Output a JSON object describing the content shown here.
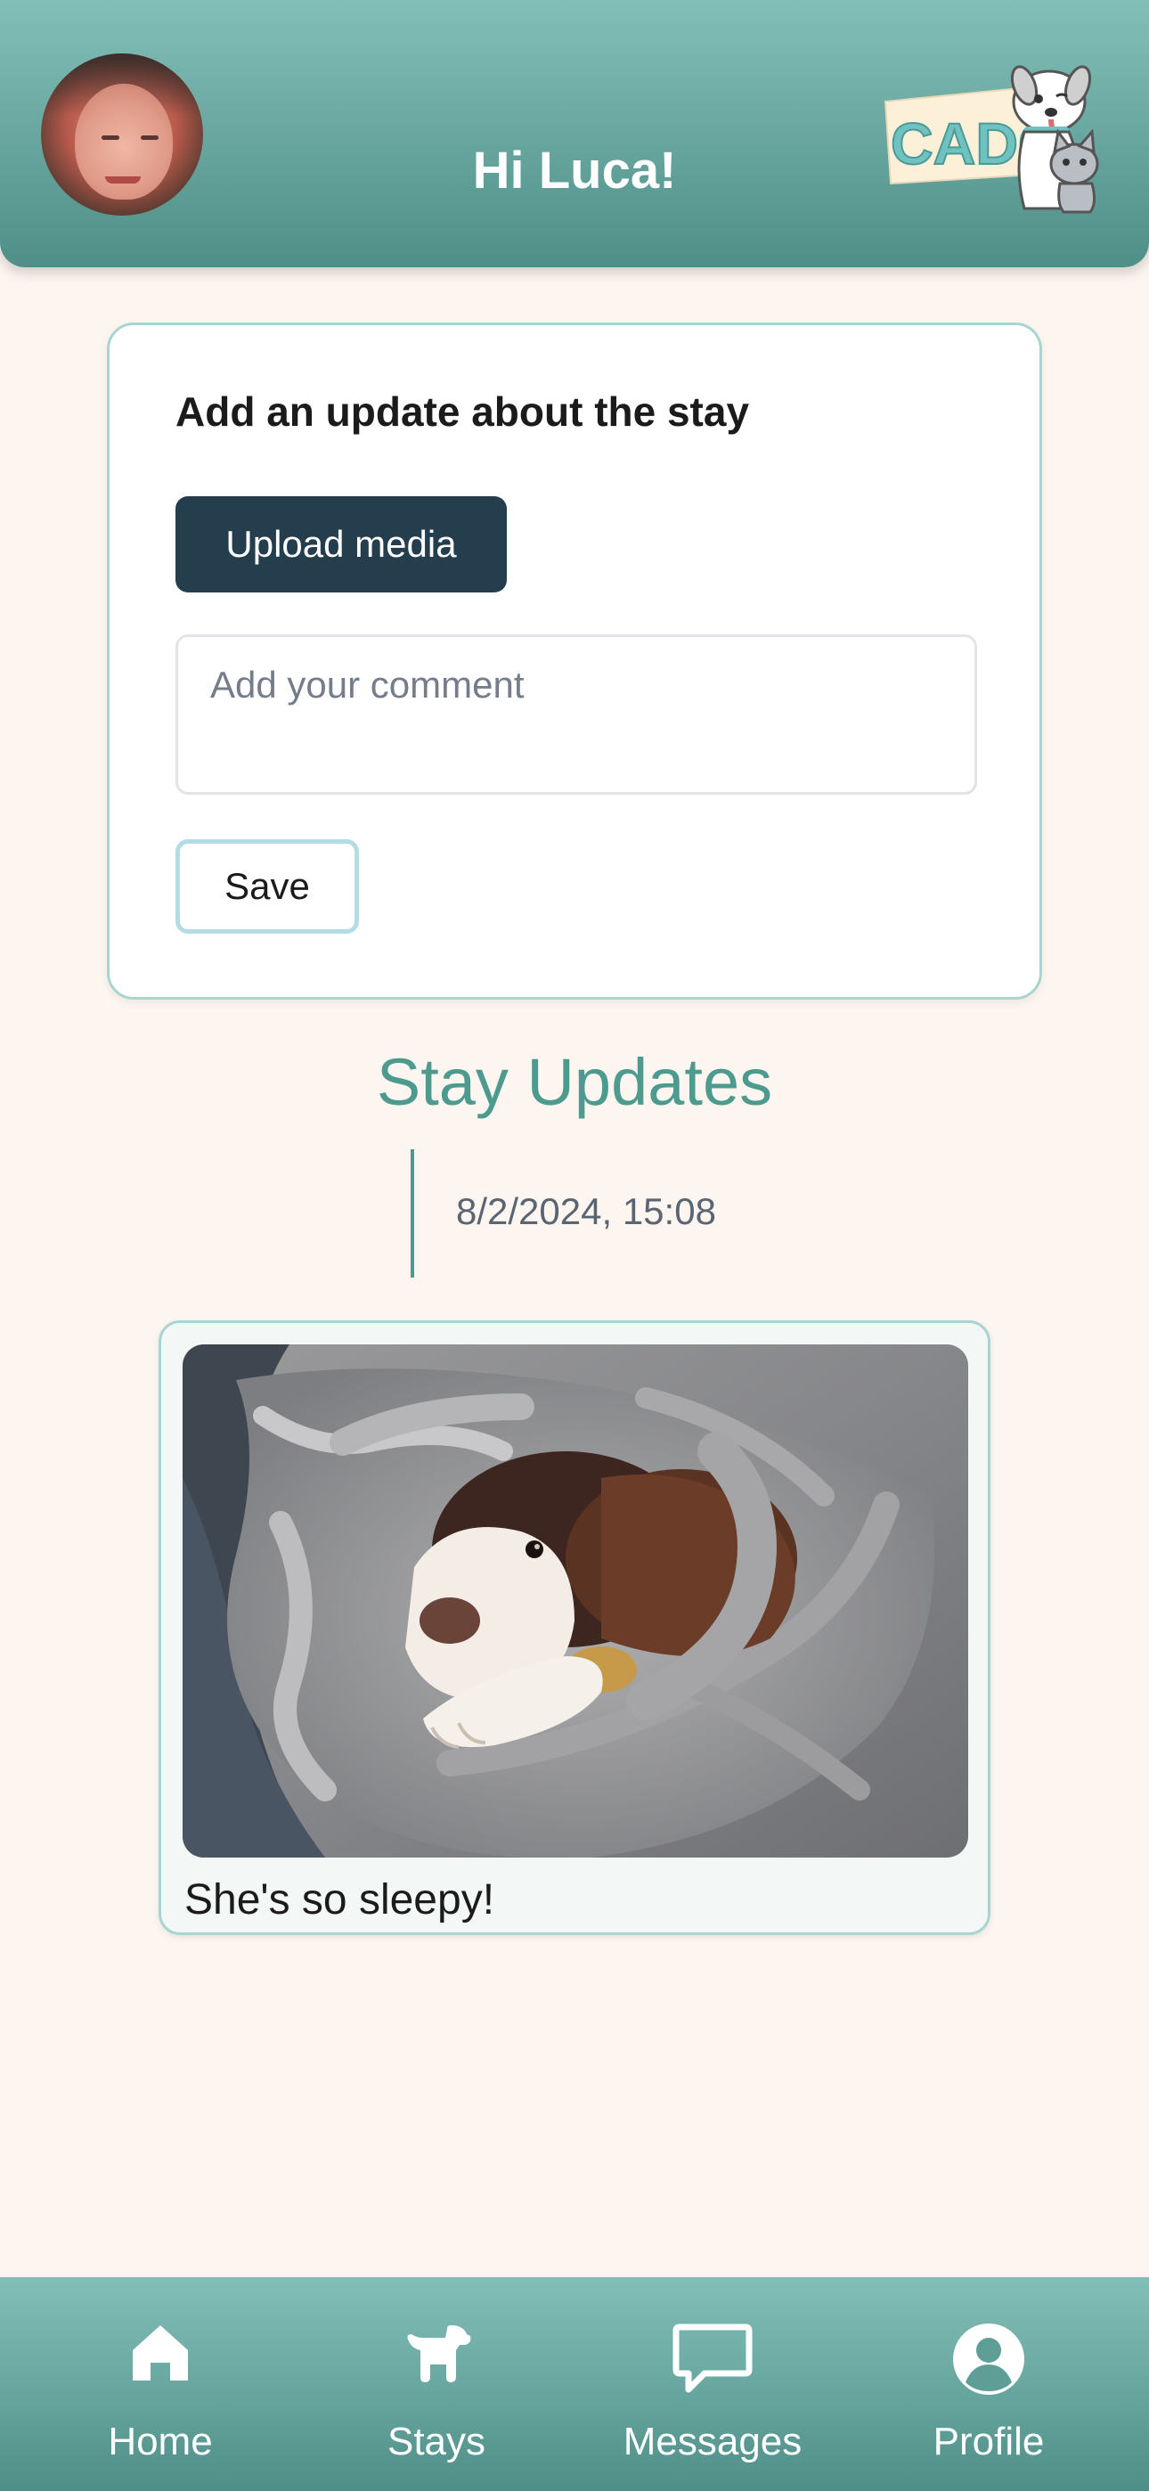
{
  "header": {
    "greeting": "Hi Luca!",
    "logo_text": "CADO"
  },
  "update_form": {
    "title": "Add an update about the stay",
    "upload_label": "Upload media",
    "comment_placeholder": "Add your comment",
    "comment_value": "",
    "save_label": "Save"
  },
  "stay_updates": {
    "title": "Stay Updates",
    "entries": [
      {
        "timestamp": "8/2/2024, 15:08",
        "caption": "She's so sleepy!"
      }
    ]
  },
  "nav": {
    "items": [
      {
        "label": "Home",
        "icon": "home-icon"
      },
      {
        "label": "Stays",
        "icon": "dog-icon"
      },
      {
        "label": "Messages",
        "icon": "chat-bubble-icon"
      },
      {
        "label": "Profile",
        "icon": "user-circle-icon"
      }
    ]
  },
  "colors": {
    "header_gradient_top": "#83bfb9",
    "header_gradient_bottom": "#4f8f88",
    "background": "#fdf5f0",
    "accent_teal": "#4d9a8f",
    "upload_button": "#243e4e",
    "card_border": "#a9d5d1"
  }
}
